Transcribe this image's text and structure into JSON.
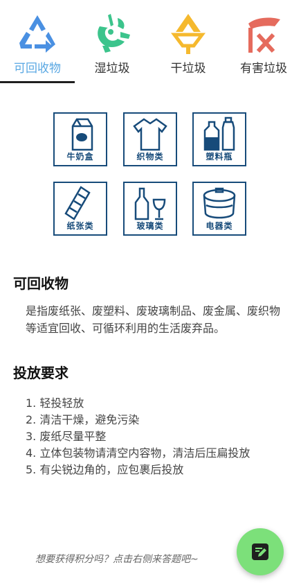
{
  "tabs": [
    {
      "label": "可回收物",
      "icon": "recycle-icon",
      "active": true
    },
    {
      "label": "湿垃圾",
      "icon": "food-waste-icon",
      "active": false
    },
    {
      "label": "干垃圾",
      "icon": "dry-waste-icon",
      "active": false
    },
    {
      "label": "有害垃圾",
      "icon": "hazardous-waste-icon",
      "active": false
    }
  ],
  "colors": {
    "active_tab": "#5aa8e3",
    "tile_border": "#174b7a",
    "fab": "#7ce07a",
    "recycle": "#4a90e2",
    "wet": "#3cc48c",
    "dry": "#f5b92e",
    "hazard": "#e56b5d"
  },
  "categories": [
    {
      "label": "牛奶盒",
      "icon": "milk-carton-icon"
    },
    {
      "label": "织物类",
      "icon": "clothing-icon"
    },
    {
      "label": "塑料瓶",
      "icon": "plastic-bottle-icon"
    },
    {
      "label": "纸张类",
      "icon": "paper-icon"
    },
    {
      "label": "玻璃类",
      "icon": "glass-icon"
    },
    {
      "label": "电器类",
      "icon": "appliance-icon"
    }
  ],
  "section": {
    "title": "可回收物",
    "description": "是指废纸张、废塑料、废玻璃制品、废金属、废织物等适宜回收、可循环利用的生活废弃品。"
  },
  "requirements": {
    "title": "投放要求",
    "items": [
      "1. 轻投轻放",
      "2. 清洁干燥，避免污染",
      "3. 废纸尽量平整",
      "4. 立体包装物请清空内容物，清洁后压扁投放",
      "5. 有尖锐边角的，应包裹后投放"
    ]
  },
  "footer": {
    "hint": "想要获得积分吗？点击右侧来答题吧~",
    "fab_icon": "edit-note-icon"
  }
}
